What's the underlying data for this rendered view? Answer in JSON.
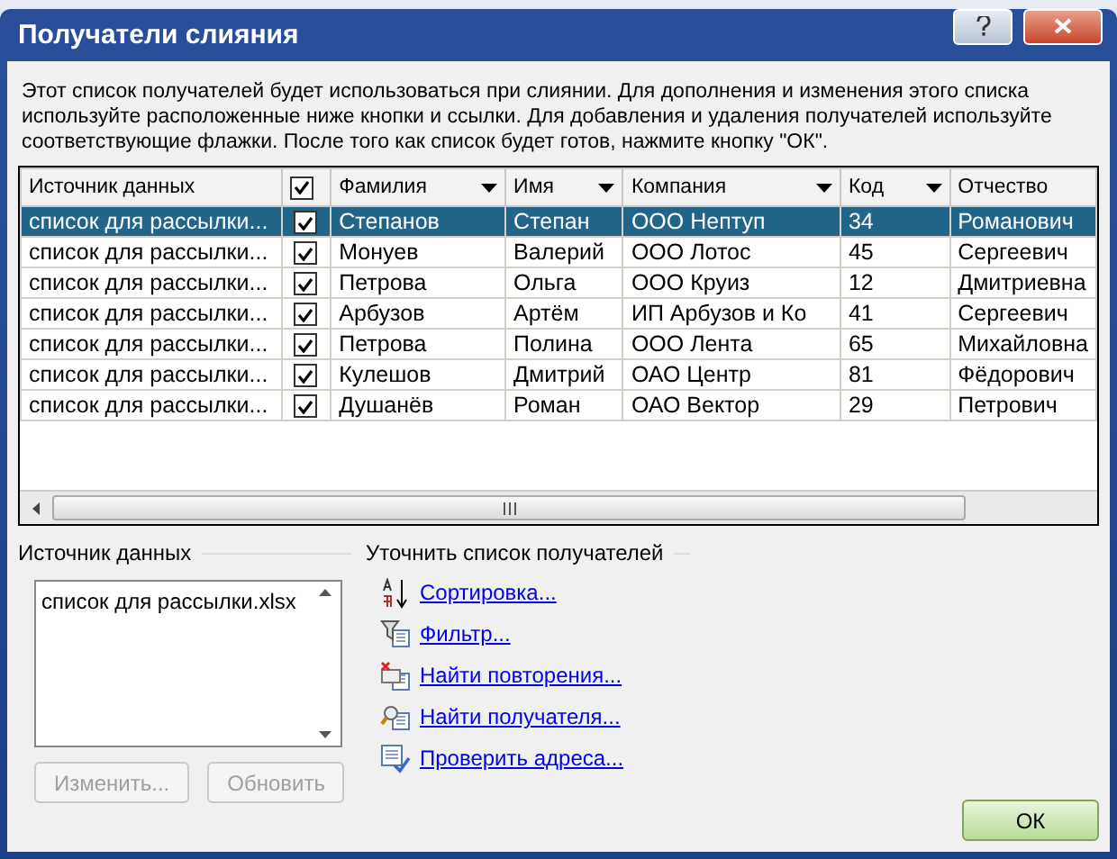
{
  "window": {
    "title": "Получатели слияния"
  },
  "description": "Этот список получателей будет использоваться при слиянии. Для дополнения и изменения этого списка используйте расположенные ниже кнопки и ссылки. Для добавления и удаления получателей используйте соответствующие флажки. После того как список будет готов, нажмите кнопку \"ОК\".",
  "table": {
    "columns": [
      {
        "kind": "text",
        "label": "Источник данных",
        "dropdown": false
      },
      {
        "kind": "checkbox",
        "checked": true
      },
      {
        "kind": "text",
        "label": "Фамилия",
        "dropdown": true
      },
      {
        "kind": "text",
        "label": "Имя",
        "dropdown": true
      },
      {
        "kind": "text",
        "label": "Компания",
        "dropdown": true
      },
      {
        "kind": "text",
        "label": "Код",
        "dropdown": true
      },
      {
        "kind": "text",
        "label": "Отчество",
        "dropdown": false
      }
    ],
    "rows": [
      {
        "checked": true,
        "selected": true,
        "cells": [
          "список для рассылки...",
          "",
          "Степанов",
          "Степан",
          "ООО Нептуп",
          "34",
          "Романович"
        ]
      },
      {
        "checked": true,
        "selected": false,
        "cells": [
          "список для рассылки...",
          "",
          "Монуев",
          "Валерий",
          "ООО Лотос",
          "45",
          "Сергеевич"
        ]
      },
      {
        "checked": true,
        "selected": false,
        "cells": [
          "список для рассылки...",
          "",
          "Петрова",
          "Ольга",
          "ООО Круиз",
          "12",
          "Дмитриевна"
        ]
      },
      {
        "checked": true,
        "selected": false,
        "cells": [
          "список для рассылки...",
          "",
          "Арбузов",
          "Артём",
          "ИП Арбузов и Ко",
          "41",
          "Сергеевич"
        ]
      },
      {
        "checked": true,
        "selected": false,
        "cells": [
          "список для рассылки...",
          "",
          "Петрова",
          "Полина",
          "ООО Лента",
          "65",
          "Михайловна"
        ]
      },
      {
        "checked": true,
        "selected": false,
        "cells": [
          "список для рассылки...",
          "",
          "Кулешов",
          "Дмитрий",
          "ОАО Центр",
          "81",
          "Фёдорович"
        ]
      },
      {
        "checked": true,
        "selected": false,
        "cells": [
          "список для рассылки...",
          "",
          "Душанёв",
          "Роман",
          "ОАО Вектор",
          "29",
          "Петрович"
        ]
      }
    ]
  },
  "data_source": {
    "heading": "Источник данных",
    "items": [
      "список для рассылки.xlsx"
    ],
    "buttons": [
      {
        "label": "Изменить...",
        "disabled": true
      },
      {
        "label": "Обновить",
        "disabled": true
      }
    ]
  },
  "refine": {
    "heading": "Уточнить список получателей",
    "links": [
      {
        "kind": "sort",
        "label": "Сортировка..."
      },
      {
        "kind": "filter",
        "label": "Фильтр..."
      },
      {
        "kind": "duplicates",
        "label": "Найти повторения..."
      },
      {
        "kind": "find",
        "label": "Найти получателя..."
      },
      {
        "kind": "validate",
        "label": "Проверить адреса..."
      }
    ]
  },
  "ok_button": "ОК"
}
